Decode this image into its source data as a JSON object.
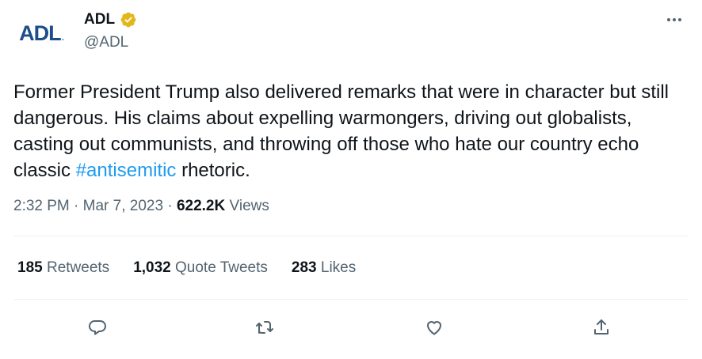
{
  "author": {
    "avatar_logo_text": "ADL",
    "display_name": "ADL",
    "handle": "@ADL",
    "verified": true,
    "verified_badge_color": "#e2b719"
  },
  "menu": {
    "more_icon": "more-horizontal-icon"
  },
  "tweet": {
    "text_before": "Former President Trump also delivered remarks that were in character but still dangerous. His claims about expelling warmongers, driving out globalists, casting out communists, and throwing off those who hate our country echo classic ",
    "hashtag": "#antisemitic",
    "text_after": " rhetoric.",
    "hashtag_color": "#1d9bf0"
  },
  "meta": {
    "time": "2:32 PM",
    "separator": "·",
    "date": "Mar 7, 2023",
    "views_count": "622.2K",
    "views_label": "Views"
  },
  "stats": {
    "retweets_count": "185",
    "retweets_label": "Retweets",
    "quotes_count": "1,032",
    "quotes_label": "Quote Tweets",
    "likes_count": "283",
    "likes_label": "Likes"
  },
  "actions": {
    "reply_icon": "reply-bubble-icon",
    "retweet_icon": "retweet-icon",
    "like_icon": "heart-icon",
    "share_icon": "share-icon",
    "icon_color": "#536471"
  }
}
